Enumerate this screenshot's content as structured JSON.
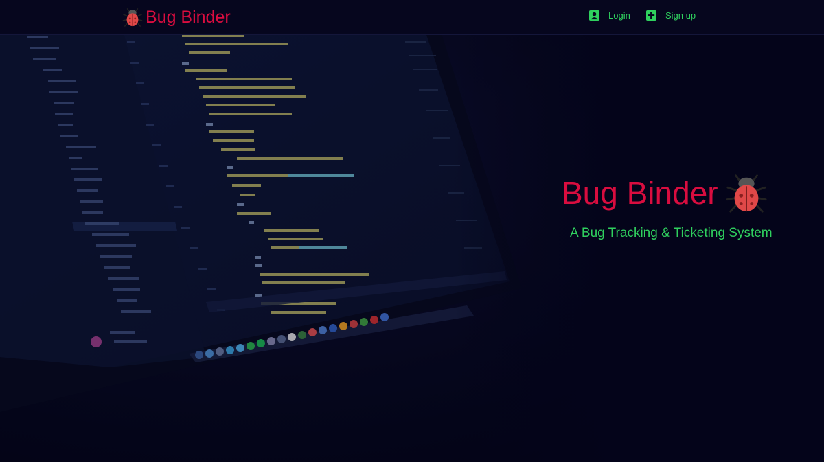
{
  "navbar": {
    "brand": {
      "icon": "bug-icon",
      "label": "Bug Binder"
    },
    "links": [
      {
        "icon": "user-square-icon",
        "label": "Login"
      },
      {
        "icon": "plus-square-icon",
        "label": "Sign up"
      }
    ]
  },
  "hero": {
    "title": "Bug Binder",
    "title_icon": "bug-icon",
    "subtitle": "A Bug Tracking & Ticketing System"
  },
  "colors": {
    "brand_red": "#d90d3f",
    "accent_green": "#2fd05e",
    "background": "#05051a"
  }
}
